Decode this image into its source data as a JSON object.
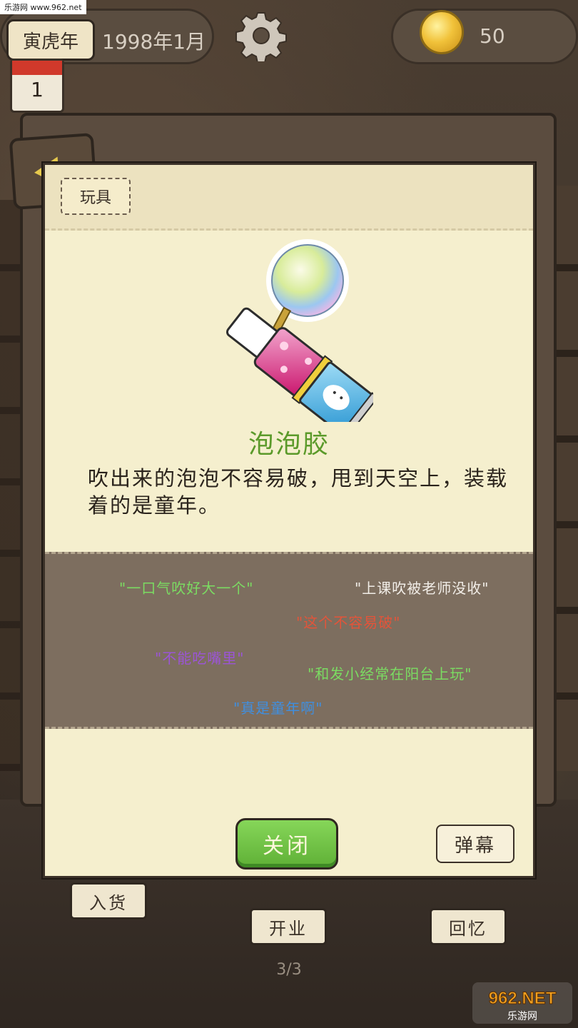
{
  "hud": {
    "year_label": "寅虎年",
    "date": "1998年1月",
    "coins": "50",
    "calendar_day": "1"
  },
  "card": {
    "category": "玩具",
    "item_name": "泡泡胶",
    "description": "吹出来的泡泡不容易破，甩到天空上，装载着的是童年。",
    "comments": [
      {
        "text": "\"一口气吹好大一个\"",
        "color": "#7bdc62"
      },
      {
        "text": "\"上课吹被老师没收\"",
        "color": "#f2eee8"
      },
      {
        "text": "\"这个不容易破\"",
        "color": "#e3543a"
      },
      {
        "text": "\"不能吃嘴里\"",
        "color": "#9b55d6"
      },
      {
        "text": "\"和发小经常在阳台上玩\"",
        "color": "#7bdc62"
      },
      {
        "text": "\"真是童年啊\"",
        "color": "#3f8fe0"
      }
    ],
    "close_label": "关闭",
    "danmaku_label": "弹幕"
  },
  "bottom": {
    "stock_label": "入货",
    "open_label": "开业",
    "memory_label": "回忆",
    "page": "3/3"
  },
  "watermark": {
    "site": "乐游网 www.962.net",
    "logo_text": "962.NET",
    "logo_sub": "乐游网"
  }
}
